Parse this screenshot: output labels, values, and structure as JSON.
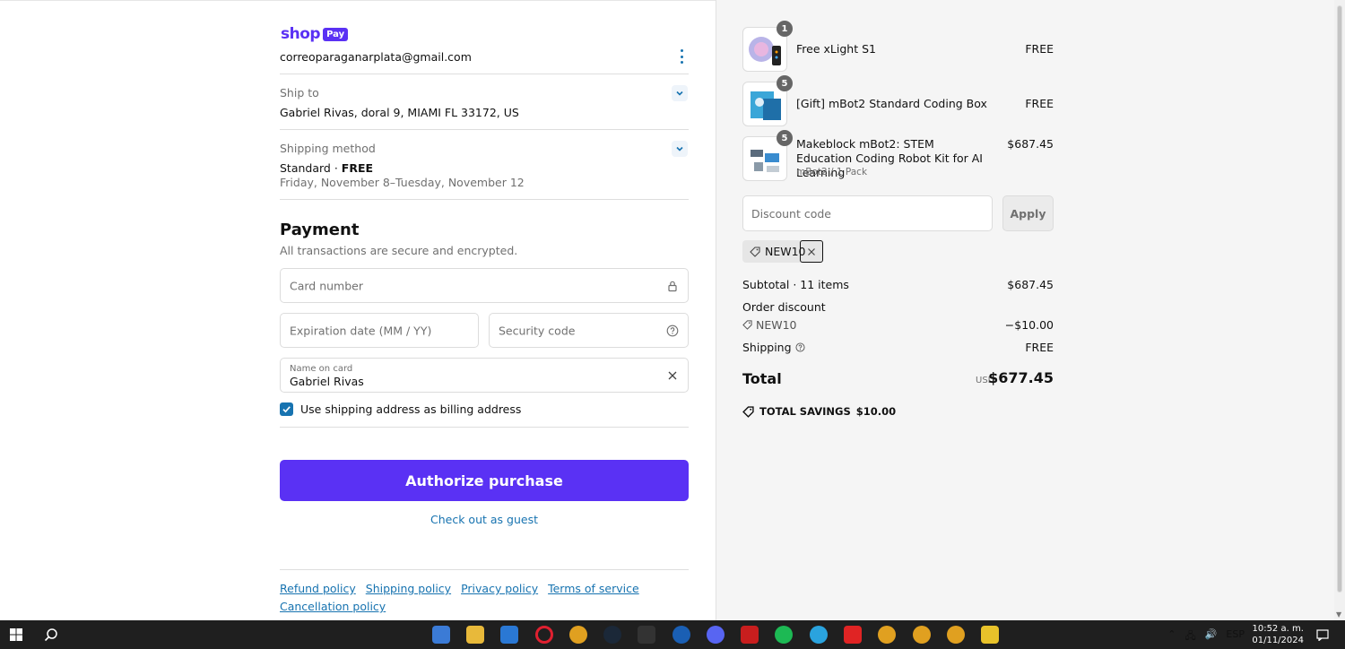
{
  "header": {
    "logo_word": "shop",
    "logo_pay": "Pay",
    "email": "correoparaganarplata@gmail.com"
  },
  "ship_to": {
    "label": "Ship to",
    "value": "Gabriel Rivas, doral 9, MIAMI FL 33172, US"
  },
  "shipping_method": {
    "label": "Shipping method",
    "name": "Standard · ",
    "price": "FREE",
    "dates": "Friday, November 8–Tuesday, November 12"
  },
  "payment": {
    "title": "Payment",
    "subtitle": "All transactions are secure and encrypted.",
    "card_number_placeholder": "Card number",
    "expiration_placeholder": "Expiration date (MM / YY)",
    "security_placeholder": "Security code",
    "name_label": "Name on card",
    "name_value": "Gabriel Rivas",
    "billing_checkbox_label": "Use shipping address as billing address",
    "billing_checked": true,
    "authorize_label": "Authorize purchase",
    "guest_label": "Check out as guest"
  },
  "footer": {
    "links": [
      "Refund policy",
      "Shipping policy",
      "Privacy policy",
      "Terms of service",
      "Cancellation policy"
    ]
  },
  "order": {
    "items": [
      {
        "qty": "1",
        "name": "Free xLight S1",
        "variant": "",
        "price": "FREE"
      },
      {
        "qty": "5",
        "name": "[Gift] mBot2 Standard Coding Box",
        "variant": "",
        "price": "FREE"
      },
      {
        "qty": "5",
        "name": "Makeblock mBot2: STEM Education Coding Robot Kit for AI Learning",
        "variant": "mBot2 / 1 Pack",
        "price": "$687.45"
      }
    ],
    "discount_placeholder": "Discount code",
    "apply_label": "Apply",
    "applied_code": "NEW10",
    "subtotal_label": "Subtotal · 11 items",
    "subtotal_value": "$687.45",
    "order_discount_label": "Order discount",
    "discount_code": "NEW10",
    "discount_value": "−$10.00",
    "shipping_label": "Shipping",
    "shipping_value": "FREE",
    "total_label": "Total",
    "total_currency": "USD",
    "total_value": "$677.45",
    "savings_label": "TOTAL SAVINGS",
    "savings_value": "$10.00"
  },
  "taskbar": {
    "language": "ESP",
    "time": "10:52 a. m.",
    "date": "01/11/2024"
  },
  "colors": {
    "accent": "#5a31f4",
    "link": "#1773b0"
  }
}
